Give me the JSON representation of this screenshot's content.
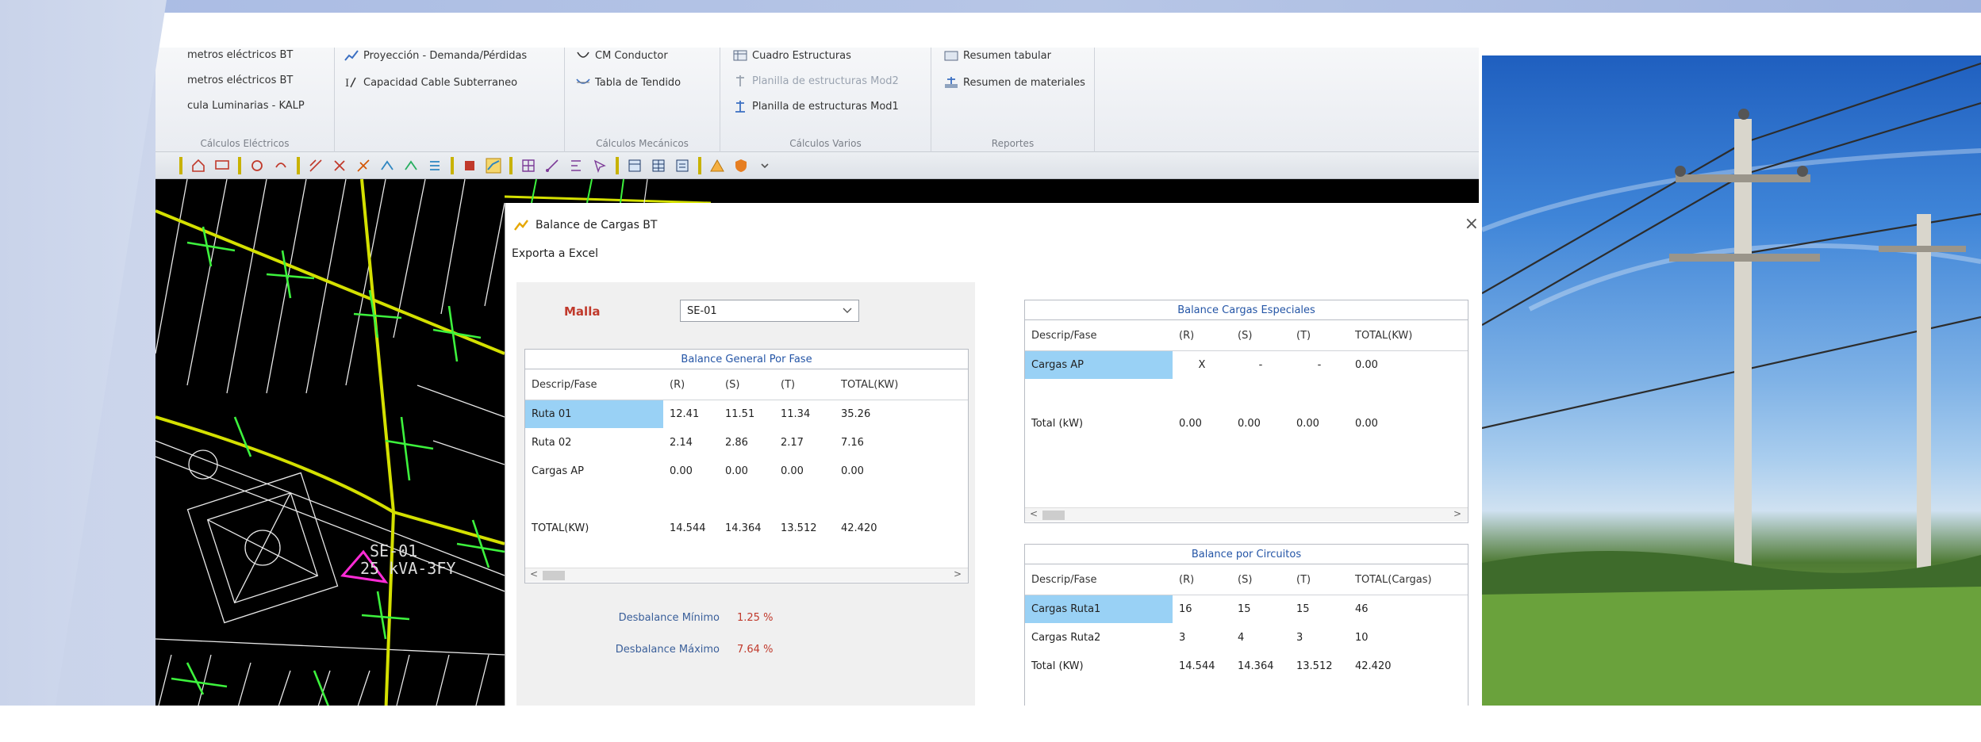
{
  "ribbon": {
    "groups": [
      {
        "label": "Cálculos Eléctricos",
        "items": [
          "metros eléctricos BT",
          "metros eléctricos BT",
          "cula Luminarias - KALP"
        ]
      },
      {
        "label": "",
        "items": [
          "Proyección - Demanda/Pérdidas",
          "Capacidad Cable Subterraneo"
        ]
      },
      {
        "label": "Cálculos Mecánicos",
        "items": [
          "CM Conductor",
          "Tabla de Tendido"
        ]
      },
      {
        "label": "Cálculos Varios",
        "items": [
          "Cuadro Estructuras",
          "Planilla de estructuras Mod2",
          "Planilla de estructuras Mod1"
        ]
      },
      {
        "label": "Reportes",
        "items": [
          "Resumen tabular",
          "Resumen de materiales"
        ]
      }
    ]
  },
  "cad": {
    "label_line1": "SE-01",
    "label_line2": "25 kVA-3FY"
  },
  "dialog": {
    "title": "Balance de Cargas BT",
    "menu": "Exporta a Excel",
    "close": "×",
    "malla_label": "Malla",
    "malla_value": "SE-01",
    "general": {
      "caption": "Balance General Por Fase",
      "headers": [
        "Descrip/Fase",
        "(R)",
        "(S)",
        "(T)",
        "TOTAL(KW)"
      ],
      "rows": [
        [
          "Ruta 01",
          "12.41",
          "11.51",
          "11.34",
          "35.26"
        ],
        [
          "Ruta 02",
          "2.14",
          "2.86",
          "2.17",
          "7.16"
        ],
        [
          "Cargas AP",
          "0.00",
          "0.00",
          "0.00",
          "0.00"
        ],
        [
          "",
          "",
          "",
          "",
          ""
        ],
        [
          "TOTAL(KW)",
          "14.544",
          "14.364",
          "13.512",
          "42.420"
        ]
      ]
    },
    "desbalance": {
      "min_label": "Desbalance Mínimo",
      "min_value": "1.25 %",
      "max_label": "Desbalance Máximo",
      "max_value": "7.64 %"
    },
    "especiales": {
      "caption": "Balance Cargas Especiales",
      "headers": [
        "Descrip/Fase",
        "(R)",
        "(S)",
        "(T)",
        "TOTAL(KW)"
      ],
      "rows": [
        [
          "Cargas AP",
          "X",
          "-",
          "-",
          "0.00"
        ],
        [
          "Total (kW)",
          "0.00",
          "0.00",
          "0.00",
          "0.00"
        ]
      ]
    },
    "circuitos": {
      "caption": "Balance por Circuitos",
      "headers": [
        "Descrip/Fase",
        "(R)",
        "(S)",
        "(T)",
        "TOTAL(Cargas)"
      ],
      "rows": [
        [
          "Cargas Ruta1",
          "16",
          "15",
          "15",
          "46"
        ],
        [
          "Cargas Ruta2",
          "3",
          "4",
          "3",
          "10"
        ],
        [
          "Total (KW)",
          "14.544",
          "14.364",
          "13.512",
          "42.420"
        ]
      ]
    }
  },
  "colors": {
    "accent_red": "#c0392b",
    "selection": "#99d1f5",
    "caption_blue": "#2455a6"
  }
}
